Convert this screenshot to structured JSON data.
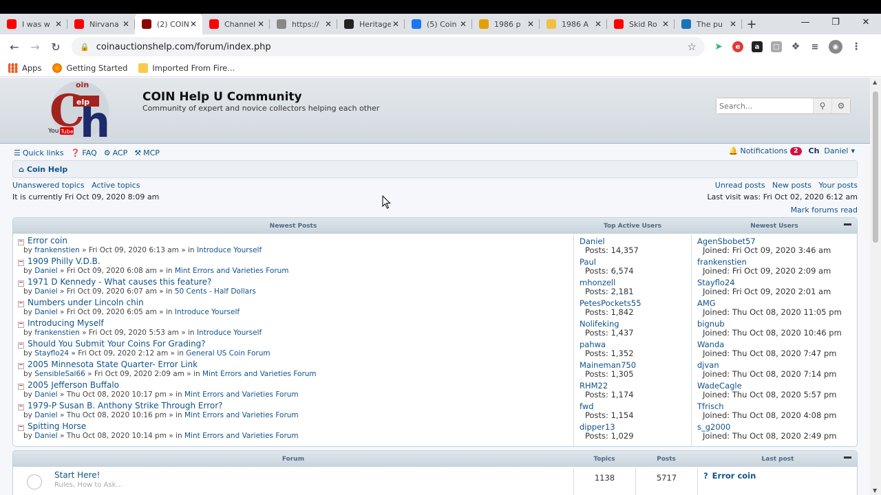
{
  "browser": {
    "tabs": [
      {
        "title": "I was w",
        "icon": "youtube-icon",
        "color": "#ff0000"
      },
      {
        "title": "Nirvana",
        "icon": "youtube-icon",
        "color": "#ff0000"
      },
      {
        "title": "(2) COIN",
        "icon": "coin-help-icon",
        "color": "#8b0000",
        "active": true
      },
      {
        "title": "Channel",
        "icon": "youtube-icon",
        "color": "#ff0000"
      },
      {
        "title": "https://",
        "icon": "globe-icon",
        "color": "#888888"
      },
      {
        "title": "Heritage",
        "icon": "heritage-icon",
        "color": "#222222"
      },
      {
        "title": "(5) Coin",
        "icon": "facebook-icon",
        "color": "#1877f2"
      },
      {
        "title": "1986 p",
        "icon": "shopping-icon",
        "color": "#e5a000"
      },
      {
        "title": "1986 A",
        "icon": "search-result-icon",
        "color": "#f0c040"
      },
      {
        "title": "Skid Ro",
        "icon": "youtube-icon",
        "color": "#ff0000"
      },
      {
        "title": "The pu",
        "icon": "site-icon",
        "color": "#1a73b8"
      }
    ],
    "new_tab": "+",
    "url": "coinauctionshelp.com/forum/index.php",
    "bookmarks": [
      {
        "label": "Apps"
      },
      {
        "label": "Getting Started"
      },
      {
        "label": "Imported From Fire..."
      }
    ]
  },
  "site": {
    "logo_text": "Coin Help YouTube",
    "name": "COIN Help U Community",
    "description": "Community of expert and novice collectors helping each other",
    "search_placeholder": "Search..."
  },
  "nav": {
    "quick_links": "Quick links",
    "faq": "FAQ",
    "acp": "ACP",
    "mcp": "MCP",
    "notifications": "Notifications",
    "notification_count": "2",
    "user": "Daniel",
    "breadcrumb": "Coin Help",
    "unanswered": "Unanswered topics",
    "active": "Active topics",
    "unread": "Unread posts",
    "new_posts": "New posts",
    "your_posts": "Your posts",
    "current_time": "It is currently Fri Oct 09, 2020 8:09 am",
    "last_visit": "Last visit was: Fri Oct 02, 2020 6:12 am",
    "mark_read": "Mark forums read"
  },
  "board": {
    "newest_posts_header": "Newest Posts",
    "top_users_header": "Top Active Users",
    "newest_users_header": "Newest Users",
    "posts": [
      {
        "title": "Error coin",
        "by": "by",
        "author": "frankenstien",
        "date": "Fri Oct 09, 2020 6:13 am",
        "in": "in",
        "forum": "Introduce Yourself"
      },
      {
        "title": "1909 Philly V.D.B.",
        "by": "by",
        "author": "Daniel",
        "date": "Fri Oct 09, 2020 6:08 am",
        "in": "in",
        "forum": "Mint Errors and Varieties Forum"
      },
      {
        "title": "1971 D Kennedy - What causes this feature?",
        "by": "by",
        "author": "Daniel",
        "date": "Fri Oct 09, 2020 6:07 am",
        "in": "in",
        "forum": "50 Cents - Half Dollars"
      },
      {
        "title": "Numbers under Lincoln chin",
        "by": "by",
        "author": "Daniel",
        "date": "Fri Oct 09, 2020 6:05 am",
        "in": "in",
        "forum": "Introduce Yourself"
      },
      {
        "title": "Introducing Myself",
        "by": "by",
        "author": "frankenstien",
        "date": "Fri Oct 09, 2020 5:53 am",
        "in": "in",
        "forum": "Introduce Yourself"
      },
      {
        "title": "Should You Submit Your Coins For Grading?",
        "by": "by",
        "author": "Stayflo24",
        "date": "Fri Oct 09, 2020 2:12 am",
        "in": "in",
        "forum": "General US Coin Forum"
      },
      {
        "title": "2005 Minnesota State Quarter- Error Link",
        "by": "by",
        "author": "SensibleSal66",
        "date": "Fri Oct 09, 2020 2:09 am",
        "in": "in",
        "forum": "Mint Errors and Varieties Forum"
      },
      {
        "title": "2005 Jefferson Buffalo",
        "by": "by",
        "author": "Daniel",
        "date": "Thu Oct 08, 2020 10:17 pm",
        "in": "in",
        "forum": "Mint Errors and Varieties Forum"
      },
      {
        "title": "1979-P Susan B. Anthony Strike Through Error?",
        "by": "by",
        "author": "Daniel",
        "date": "Thu Oct 08, 2020 10:16 pm",
        "in": "in",
        "forum": "Mint Errors and Varieties Forum"
      },
      {
        "title": "Spitting Horse",
        "by": "by",
        "author": "Daniel",
        "date": "Thu Oct 08, 2020 10:14 pm",
        "in": "in",
        "forum": "Mint Errors and Varieties Forum"
      }
    ],
    "top_users": [
      {
        "name": "Daniel",
        "posts": "Posts: 14,357"
      },
      {
        "name": "Paul",
        "posts": "Posts: 6,574"
      },
      {
        "name": "mhonzell",
        "posts": "Posts: 2,181"
      },
      {
        "name": "PetesPockets55",
        "posts": "Posts: 1,842"
      },
      {
        "name": "Nolifeking",
        "posts": "Posts: 1,437"
      },
      {
        "name": "pahwa",
        "posts": "Posts: 1,352"
      },
      {
        "name": "Maineman750",
        "posts": "Posts: 1,305"
      },
      {
        "name": "RHM22",
        "posts": "Posts: 1,174"
      },
      {
        "name": "fwd",
        "posts": "Posts: 1,154"
      },
      {
        "name": "dipper13",
        "posts": "Posts: 1,029"
      }
    ],
    "newest_users": [
      {
        "name": "AgenSbobet57",
        "joined": "Joined: Fri Oct 09, 2020 3:46 am"
      },
      {
        "name": "frankenstien",
        "joined": "Joined: Fri Oct 09, 2020 2:09 am"
      },
      {
        "name": "Stayflo24",
        "joined": "Joined: Fri Oct 09, 2020 2:01 am"
      },
      {
        "name": "AMG",
        "joined": "Joined: Thu Oct 08, 2020 11:05 pm"
      },
      {
        "name": "bignub",
        "joined": "Joined: Thu Oct 08, 2020 10:46 pm"
      },
      {
        "name": "Wanda",
        "joined": "Joined: Thu Oct 08, 2020 7:47 pm"
      },
      {
        "name": "djvan",
        "joined": "Joined: Thu Oct 08, 2020 7:14 pm"
      },
      {
        "name": "WadeCagle",
        "joined": "Joined: Thu Oct 08, 2020 5:57 pm"
      },
      {
        "name": "Tfrisch",
        "joined": "Joined: Thu Oct 08, 2020 4:08 pm"
      },
      {
        "name": "s_g2000",
        "joined": "Joined: Thu Oct 08, 2020 2:49 pm"
      }
    ]
  },
  "forum_list": {
    "col_forum": "Forum",
    "col_topics": "Topics",
    "col_posts": "Posts",
    "col_last_post": "Last post",
    "rows": [
      {
        "title": "Start Here!",
        "desc": "Rules, How to Ask...",
        "topics": "1138",
        "posts": "5717",
        "last_post": "Error coin"
      }
    ]
  }
}
